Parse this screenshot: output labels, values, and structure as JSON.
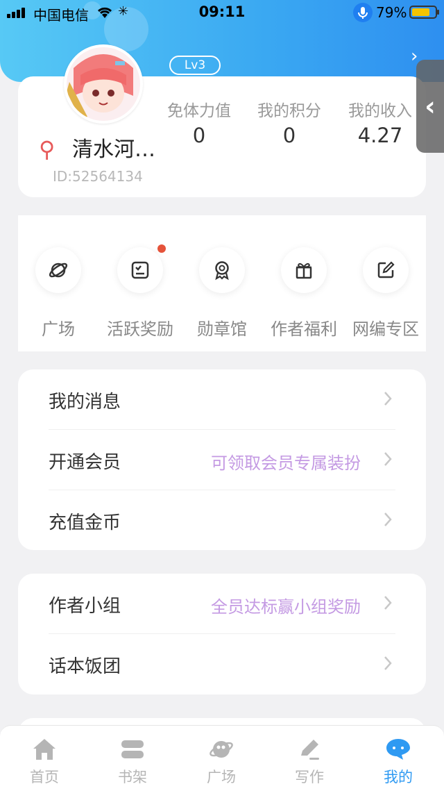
{
  "status_bar": {
    "carrier": "中国电信",
    "time": "09:11",
    "battery": "79%"
  },
  "profile": {
    "level": "Lv3",
    "username": "清水河…",
    "user_id": "ID:52564134",
    "stats": [
      {
        "label": "免体力值",
        "value": "0"
      },
      {
        "label": "我的积分",
        "value": "0"
      },
      {
        "label": "我的收入",
        "value": "4.27"
      }
    ]
  },
  "quick_actions": [
    {
      "label": "广场",
      "icon": "planet-icon"
    },
    {
      "label": "活跃奖励",
      "icon": "checklist-icon"
    },
    {
      "label": "勋章馆",
      "icon": "medal-icon"
    },
    {
      "label": "作者福利",
      "icon": "gift-icon"
    },
    {
      "label": "网编专区",
      "icon": "edit-icon"
    }
  ],
  "menu_group_1": [
    {
      "label": "我的消息",
      "hint": ""
    },
    {
      "label": "开通会员",
      "hint": "可领取会员专属装扮"
    },
    {
      "label": "充值金币",
      "hint": ""
    }
  ],
  "menu_group_2": [
    {
      "label": "作者小组",
      "hint": "全员达标赢小组奖励"
    },
    {
      "label": "话本饭团",
      "hint": ""
    }
  ],
  "tabbar": [
    {
      "label": "首页",
      "icon": "home-icon"
    },
    {
      "label": "书架",
      "icon": "bookshelf-icon"
    },
    {
      "label": "广场",
      "icon": "planet-icon"
    },
    {
      "label": "写作",
      "icon": "pen-icon"
    },
    {
      "label": "我的",
      "icon": "chat-bubble-icon",
      "active": true
    }
  ],
  "colors": {
    "header_gradient_start": "#57c9f5",
    "header_gradient_end": "#2e8ff0",
    "accent": "#2f9af2",
    "hint_purple": "#c49ae3",
    "notification_dot": "#e5533a"
  }
}
